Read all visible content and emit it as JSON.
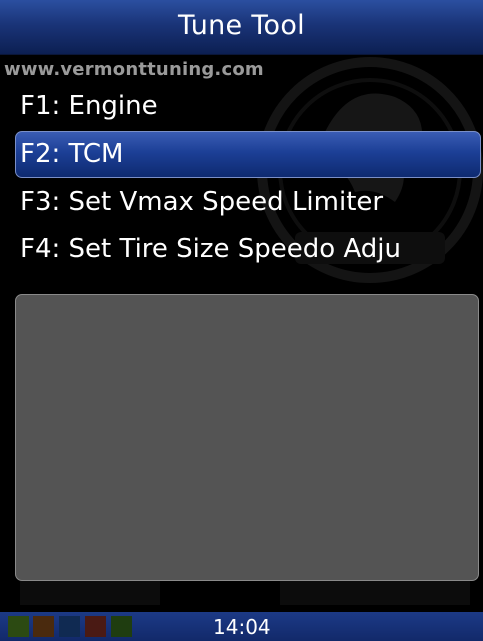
{
  "title_bar": {
    "title": "Tune Tool"
  },
  "watermark": {
    "url": "www.vermonttuning.com"
  },
  "menu": {
    "items": [
      {
        "label": "F1: Engine",
        "selected": false
      },
      {
        "label": "F2: TCM",
        "selected": true
      },
      {
        "label": "F3: Set Vmax Speed Limiter",
        "selected": false
      },
      {
        "label": "F4: Set Tire Size Speedo Adju",
        "selected": false
      }
    ]
  },
  "info_panel": {
    "text": ""
  },
  "status_bar": {
    "time": "14:04",
    "indicators": [
      {
        "name": "indicator-1",
        "color": "#2c4a12"
      },
      {
        "name": "indicator-2",
        "color": "#4a2a0e"
      },
      {
        "name": "indicator-3",
        "color": "#102a52"
      },
      {
        "name": "indicator-4",
        "color": "#4a1a14"
      },
      {
        "name": "indicator-5",
        "color": "#1f3d10"
      }
    ]
  },
  "colors": {
    "accent": "#1c3f96",
    "panel": "#545454",
    "background": "#000000"
  }
}
